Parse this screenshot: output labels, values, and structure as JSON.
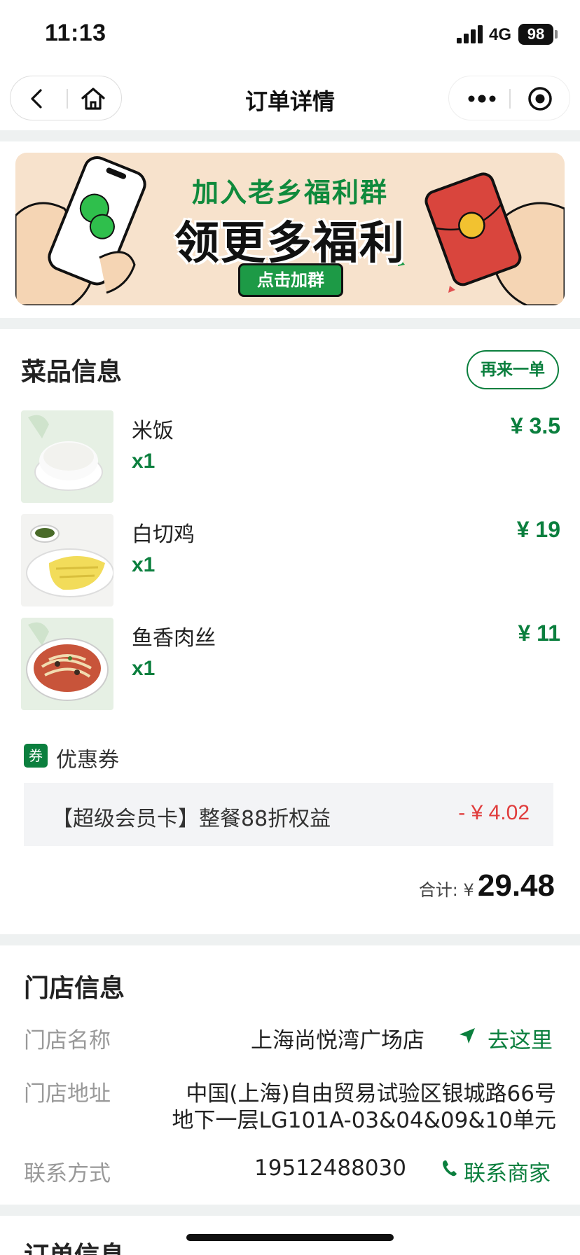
{
  "status_bar": {
    "time": "11:13",
    "network": "4G",
    "battery": "98"
  },
  "navbar": {
    "title": "订单详情"
  },
  "banner": {
    "line1": "加入老乡福利群",
    "line2": "领更多福利",
    "button": "点击加群"
  },
  "dishes_section": {
    "title": "菜品信息",
    "reorder_label": "再来一单",
    "items": [
      {
        "name": "米饭",
        "qty": "x1",
        "price": "¥ 3.5"
      },
      {
        "name": "白切鸡",
        "qty": "x1",
        "price": "¥ 19"
      },
      {
        "name": "鱼香肉丝",
        "qty": "x1",
        "price": "¥ 11"
      }
    ],
    "coupon": {
      "badge": "券",
      "label": "优惠券",
      "name": "【超级会员卡】整餐88折权益",
      "amount": "- ¥ 4.02"
    },
    "total": {
      "label": "合计: ¥",
      "value": "29.48"
    }
  },
  "store_section": {
    "title": "门店信息",
    "name_label": "门店名称",
    "name_value": "上海尚悦湾广场店",
    "go_label": "去这里",
    "address_label": "门店地址",
    "address_line1": "中国(上海)自由贸易试验区银城路66号",
    "address_line2": "地下一层LG101A-03&04&09&10单元",
    "contact_label": "联系方式",
    "contact_value": "19512488030",
    "contact_action": "联系商家"
  },
  "order_section": {
    "title": "订单信息"
  },
  "colors": {
    "brand_green": "#0b7f3e",
    "discount_red": "#e03c3c",
    "divider": "#eef1f1"
  },
  "icons": [
    "signal-icon",
    "back-icon",
    "home-icon",
    "more-icon",
    "target-icon",
    "navigate-icon",
    "phone-icon"
  ]
}
